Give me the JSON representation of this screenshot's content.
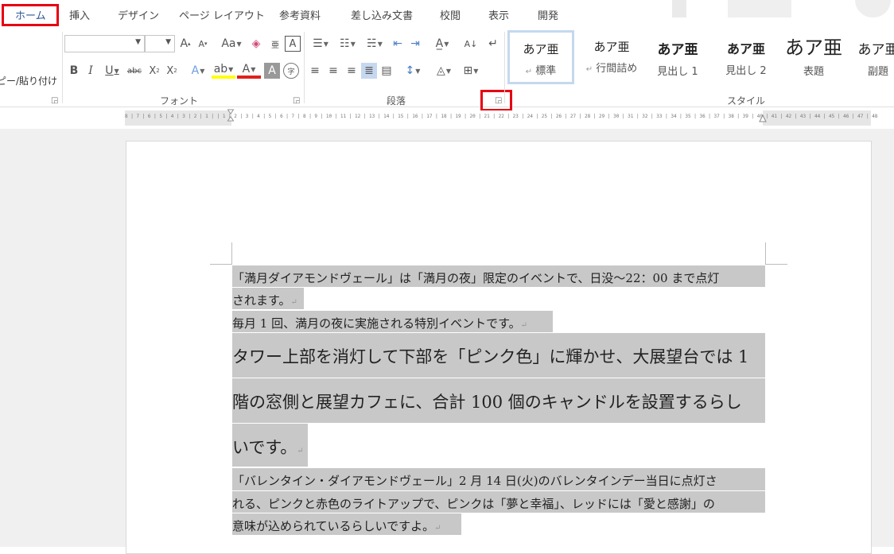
{
  "tabs": [
    "ホーム",
    "挿入",
    "デザイン",
    "ページ レイアウト",
    "参考資料",
    "差し込み文書",
    "校閲",
    "表示",
    "開発"
  ],
  "active_tab": "ホーム",
  "clipboard": {
    "paste_label": "ピー/貼り付け"
  },
  "groups": {
    "font": "フォント",
    "paragraph": "段落",
    "styles": "スタイル"
  },
  "font": {
    "name_value": "",
    "size_value": ""
  },
  "styles": [
    {
      "preview": "あア亜",
      "name": "標準",
      "mark": "↵"
    },
    {
      "preview": "あア亜",
      "name": "行間詰め",
      "mark": "↵"
    },
    {
      "preview": "あア亜",
      "name": "見出し 1",
      "mark": ""
    },
    {
      "preview": "あア亜",
      "name": "見出し 2",
      "mark": ""
    },
    {
      "preview": "あア亜",
      "name": "表題",
      "mark": ""
    },
    {
      "preview": "あア亜",
      "name": "副題",
      "mark": ""
    }
  ],
  "ruler_text": "8 | 7 | 6 | 5 | 4 | 3 | 2 | 1 |     | 1 | 2 | 3 | 4 | 5 | 6 | 7 | 8 | 9 | 10 | 11 | 12 | 13 | 14 | 15 | 16 | 17 | 18 | 19 | 20 | 21 | 22 | 23 | 24 | 25 | 26 | 27 | 28 | 29 | 30 | 31 | 32 | 33 | 34 | 35 | 36 | 37 | 38 | 39 | 40 | 41 | 42 | 43 | 44 | 45 | 46 | 47 | 48",
  "document": {
    "lines": [
      "「満月ダイアモンドヴェール」は「満月の夜」限定のイベントで、日没〜22：00 まで点灯",
      "されます。",
      "毎月 1 回、満月の夜に実施される特別イベントです。",
      "タワー上部を消灯して下部を「ピンク色」に輝かせ、大展望台では 1",
      "階の窓側と展望カフェに、合計 100 個のキャンドルを設置するらし",
      "いです。",
      "「バレンタイン・ダイアモンドヴェール」2 月 14 日(火)のバレンタインデー当日に点灯さ",
      "れる、ピンクと赤色のライトアップで、ピンクは「夢と幸福」、レッドには「愛と感謝」の",
      "意味が込められているらしいですよ。"
    ],
    "paragraph_mark": "↵"
  },
  "colors": {
    "accent": "#2b579a",
    "highlight_box": "#e60012",
    "selection": "#c8c8c8"
  }
}
